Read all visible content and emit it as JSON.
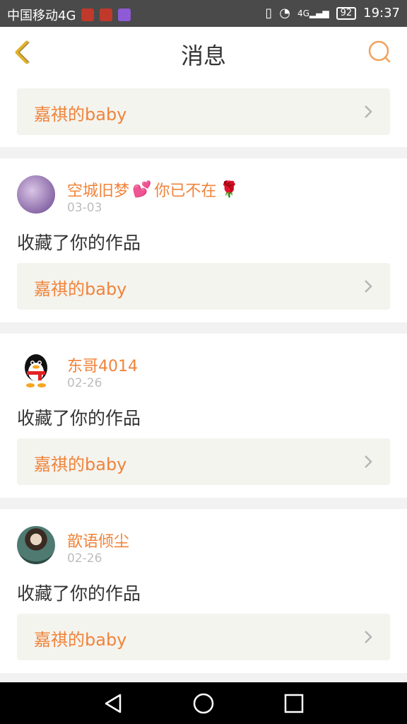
{
  "status_bar": {
    "carrier": "中国移动4G",
    "battery": "92",
    "time": "19:37",
    "signal_label": "4G"
  },
  "header": {
    "title": "消息"
  },
  "first_item": {
    "work_label": "嘉祺的baby"
  },
  "messages": [
    {
      "username": "空城旧梦",
      "username_suffix": "你已不在",
      "date": "03-03",
      "action": "收藏了你的作品",
      "work_label": "嘉祺的baby"
    },
    {
      "username": "东哥4014",
      "date": "02-26",
      "action": "收藏了你的作品",
      "work_label": "嘉祺的baby"
    },
    {
      "username": "歆语倾尘",
      "date": "02-26",
      "action": "收藏了你的作品",
      "work_label": "嘉祺的baby"
    }
  ],
  "colors": {
    "accent": "#f0833a",
    "card_bg": "#f4f4ef"
  }
}
